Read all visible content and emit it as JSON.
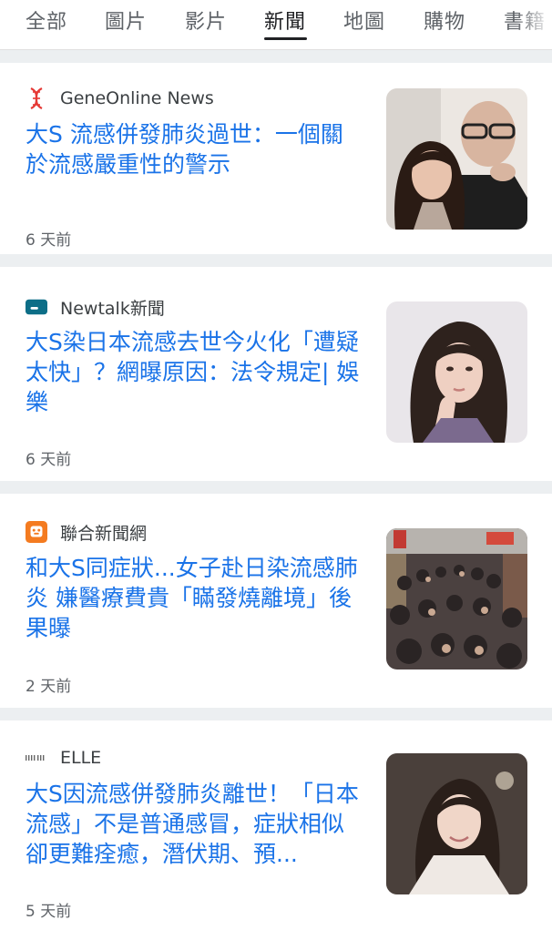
{
  "tabs": [
    {
      "label": "全部",
      "active": false
    },
    {
      "label": "圖片",
      "active": false
    },
    {
      "label": "影片",
      "active": false
    },
    {
      "label": "新聞",
      "active": true
    },
    {
      "label": "地圖",
      "active": false
    },
    {
      "label": "購物",
      "active": false
    },
    {
      "label": "書籍",
      "active": false
    }
  ],
  "articles": [
    {
      "source": "GeneOnline News",
      "source_icon": "dna-helix-icon",
      "headline": "大S 流感併發肺炎過世：一個關於流感嚴重性的警示",
      "time": "6 天前",
      "thumbnail": "couple-photo"
    },
    {
      "source": "Newtalk新聞",
      "source_icon": "newtalk-logo-icon",
      "headline": "大S染日本流感去世今火化「遭疑太快」？網曝原因：法令規定| 娛樂",
      "time": "6 天前",
      "thumbnail": "woman-portrait-photo"
    },
    {
      "source": "聯合新聞網",
      "source_icon": "udn-logo-icon",
      "headline": "和大S同症狀...女子赴日染流感肺炎 嫌醫療費貴「瞞發燒離境」後果曝",
      "time": "2 天前",
      "thumbnail": "crowded-street-photo"
    },
    {
      "source": "ELLE",
      "source_icon": "elle-logo-icon",
      "headline": "大S因流感併發肺炎離世！「日本流感」不是普通感冒，症狀相似卻更難痊癒，潛伏期、預...",
      "time": "5 天前",
      "thumbnail": "woman-smiling-photo"
    }
  ],
  "colors": {
    "headline": "#1a73e8",
    "separator": "#eceff1",
    "newtalk": "#0d6e87",
    "udn": "#f47b20",
    "dna": "#e53935"
  }
}
